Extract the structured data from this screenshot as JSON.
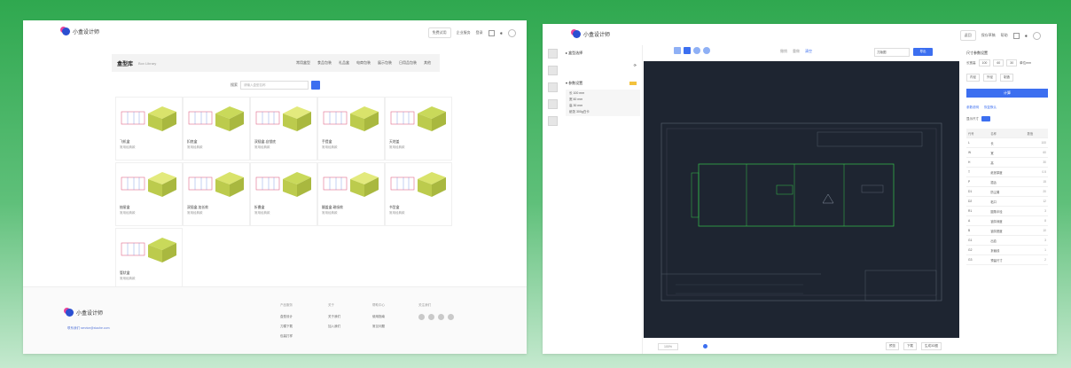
{
  "left": {
    "logo_text": "小盒设计师",
    "top_actions": [
      "免费试用",
      "企业服务",
      "登录"
    ],
    "nav": {
      "title": "盒型库",
      "subtitle": "Box Library",
      "links": [
        "常用盒型",
        "食品包装",
        "礼品盒",
        "电商包装",
        "展示包装",
        "日用品包装",
        "其他"
      ]
    },
    "search": {
      "label": "搜索",
      "placeholder": "请输入盒型名称"
    },
    "cards": [
      {
        "name": "飞机盒",
        "sub": "常用经典款"
      },
      {
        "name": "扣底盒",
        "sub": "常用经典款"
      },
      {
        "name": "双插盒-自锁底",
        "sub": "常用经典款"
      },
      {
        "name": "手提盒",
        "sub": "常用经典款"
      },
      {
        "name": "天地盖",
        "sub": "常用经典款"
      },
      {
        "name": "抽屉盒",
        "sub": "常用经典款"
      },
      {
        "name": "双插盒-加长款",
        "sub": "常用经典款"
      },
      {
        "name": "折叠盒",
        "sub": "常用经典款"
      },
      {
        "name": "翻盖盒-磁吸款",
        "sub": "常用经典款"
      },
      {
        "name": "书型盒",
        "sub": "常用经典款"
      },
      {
        "name": "管状盒",
        "sub": "常用经典款"
      }
    ],
    "footer": {
      "logo_text": "小盒设计师",
      "link": "联系我们 service@xiaohe.com",
      "cols": [
        {
          "head": "产品服务",
          "items": [
            "盒型设计",
            "刀模下载",
            "包装打样"
          ]
        },
        {
          "head": "关于",
          "items": [
            "关于我们",
            "加入我们"
          ]
        },
        {
          "head": "帮助中心",
          "items": [
            "使用指南",
            "常见问题"
          ]
        },
        {
          "head": "关注我们",
          "items": []
        }
      ]
    }
  },
  "right": {
    "logo_text": "小盒设计师",
    "top_actions": [
      "返回",
      "保存草稿",
      "帮助"
    ],
    "side": {
      "item1": "盒型选择",
      "item2": "参数设置",
      "params": [
        "长 100 mm",
        "宽 60 mm",
        "高 30 mm",
        "纸张 300g白卡"
      ]
    },
    "undo": [
      "撤销",
      "重做",
      "清空"
    ],
    "select_value": "刀版图",
    "export_label": "导出",
    "bottom": {
      "zoom": "100%",
      "buttons": [
        "预览",
        "下载",
        "生成3D图"
      ]
    },
    "panel": {
      "title": "尺寸参数设置",
      "row": [
        "长宽高",
        "100",
        "60",
        "30",
        "单位mm"
      ],
      "tabs": [
        "内径",
        "外径",
        "制造"
      ],
      "calc_label": "计算",
      "links": [
        "参数说明",
        "恢复默认"
      ],
      "toggle_label": "显示尺寸"
    },
    "params_table": {
      "headers": [
        "代号",
        "名称",
        "数值"
      ],
      "rows": [
        [
          "L",
          "长",
          "100"
        ],
        [
          "W",
          "宽",
          "60"
        ],
        [
          "H",
          "高",
          "30"
        ],
        [
          "T",
          "纸张厚度",
          "0.5"
        ],
        [
          "P",
          "插舌",
          "15"
        ],
        [
          "D1",
          "防尘翼",
          "20"
        ],
        [
          "D2",
          "粘口",
          "12"
        ],
        [
          "R1",
          "圆角半径",
          "3"
        ],
        [
          "A",
          "锁扣深度",
          "8"
        ],
        [
          "B",
          "锁扣宽度",
          "10"
        ],
        [
          "G1",
          "出血",
          "3"
        ],
        [
          "G2",
          "折痕线",
          "1"
        ],
        [
          "G3",
          "预留尺寸",
          "2"
        ]
      ]
    }
  }
}
